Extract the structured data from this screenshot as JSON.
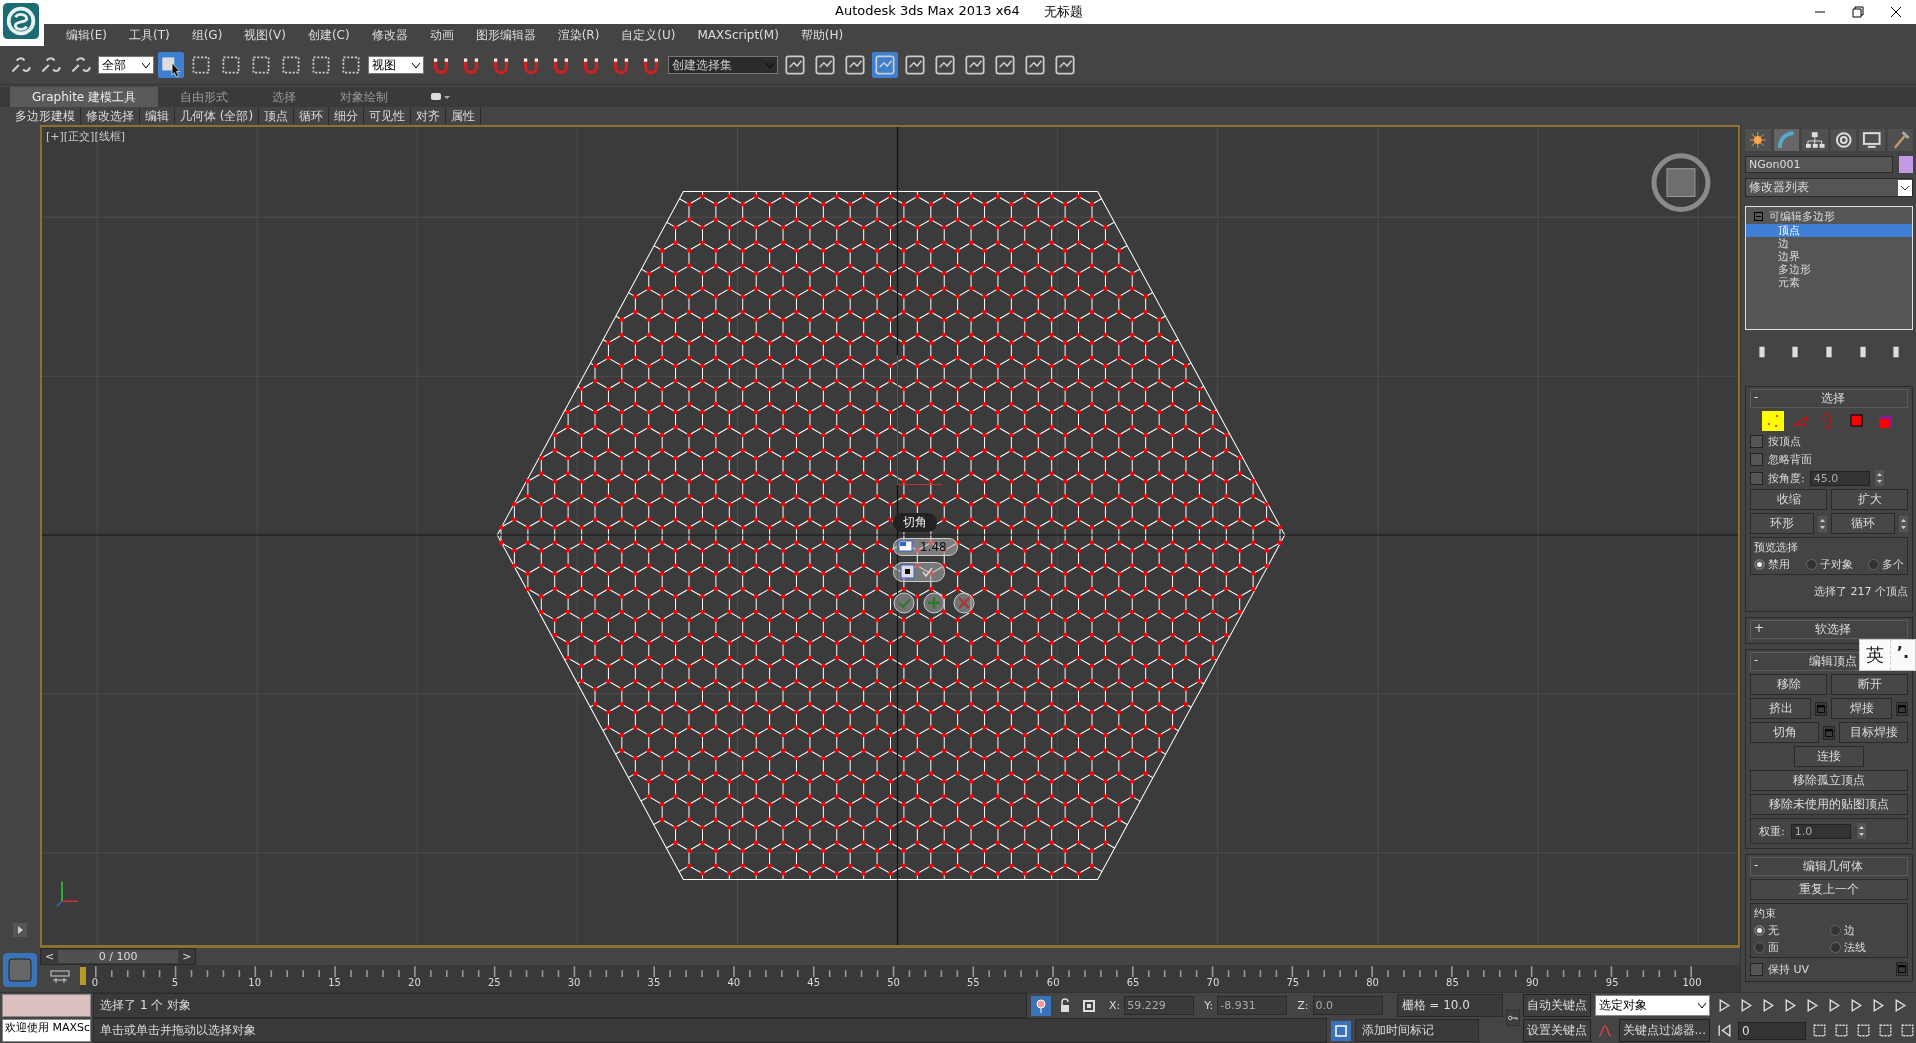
{
  "window": {
    "title": "Autodesk 3ds Max  2013 x64",
    "document": "无标题"
  },
  "menu": [
    "编辑(E)",
    "工具(T)",
    "组(G)",
    "视图(V)",
    "创建(C)",
    "修改器",
    "动画",
    "图形编辑器",
    "渲染(R)",
    "自定义(U)",
    "MAXScript(M)",
    "帮助(H)"
  ],
  "toolbar": {
    "selection_filter": "全部",
    "coordinate_system": "视图",
    "named_selection": "创建选择集"
  },
  "ribbon": {
    "tabs": [
      {
        "label": "Graphite 建模工具",
        "selected": true
      },
      {
        "label": "自由形式",
        "selected": false
      },
      {
        "label": "选择",
        "selected": false
      },
      {
        "label": "对象绘制",
        "selected": false
      }
    ],
    "panels": [
      "多边形建模",
      "修改选择",
      "编辑",
      "几何体 (全部)",
      "顶点",
      "循环",
      "细分",
      "可见性",
      "对齐",
      "属性"
    ]
  },
  "viewport": {
    "label": "[+][正交][线框]",
    "caddy": {
      "title": "切角",
      "value": "1.48"
    }
  },
  "command_panel": {
    "object": {
      "name": "NGon001",
      "color": "#c39ae6"
    },
    "modifier_list": "修改器列表",
    "stack": {
      "label": "可编辑多边形",
      "children": [
        {
          "label": "顶点",
          "selected": true
        },
        {
          "label": "边",
          "selected": false
        },
        {
          "label": "边界",
          "selected": false
        },
        {
          "label": "多边形",
          "selected": false
        },
        {
          "label": "元素",
          "selected": false
        }
      ]
    },
    "selection": {
      "toggle": "-",
      "title": "选择",
      "levels": [
        {
          "kind": "vertex",
          "selected": true
        },
        {
          "kind": "edge",
          "selected": false
        },
        {
          "kind": "border",
          "selected": false
        },
        {
          "kind": "polygon",
          "selected": false
        },
        {
          "kind": "element",
          "selected": false
        }
      ],
      "by_vertex": {
        "label": "按顶点",
        "checked": false
      },
      "ignore_backfacing": {
        "label": "忽略背面",
        "checked": false
      },
      "by_angle": {
        "label": "按角度:",
        "checked": false,
        "value": "45.0"
      },
      "buttons": [
        "收缩",
        "扩大"
      ],
      "spin_buttons": [
        "环形",
        "循环"
      ],
      "preview": {
        "title": "预览选择",
        "options": [
          {
            "label": "禁用",
            "selected": true
          },
          {
            "label": "子对象",
            "selected": false
          },
          {
            "label": "多个",
            "selected": false
          }
        ]
      },
      "status": "选择了 217 个顶点"
    },
    "soft_selection": {
      "toggle": "+",
      "title": "软选择"
    },
    "edit_vertices": {
      "toggle": "-",
      "title": "编辑顶点",
      "rows": [
        [
          {
            "label": "移除",
            "settings": false
          },
          {
            "label": "断开",
            "settings": false
          }
        ],
        [
          {
            "label": "挤出",
            "settings": true
          },
          {
            "label": "焊接",
            "settings": true
          }
        ],
        [
          {
            "label": "切角",
            "settings": true
          },
          {
            "label": "目标焊接",
            "settings": false
          }
        ],
        [
          {
            "label": "连接",
            "settings": false
          }
        ],
        [
          {
            "label": "移除孤立顶点",
            "settings": false
          }
        ],
        [
          {
            "label": "移除未使用的贴图顶点",
            "settings": false
          }
        ]
      ],
      "weight": {
        "label": "权重:",
        "value": "1.0"
      }
    },
    "edit_geometry": {
      "toggle": "-",
      "title": "编辑几何体",
      "repeat": "重复上一个",
      "constraints": {
        "title": "约束",
        "options": [
          {
            "label": "无",
            "selected": true
          },
          {
            "label": "边",
            "selected": false
          },
          {
            "label": "面",
            "selected": false
          },
          {
            "label": "法线",
            "selected": false
          }
        ]
      },
      "preserve_uv": {
        "label": "保持 UV",
        "checked": false
      }
    }
  },
  "ime": {
    "mode": "英",
    "punctuation": "’."
  },
  "timeline": {
    "prev": "<",
    "frame": "0 / 100",
    "next": ">",
    "ticks": [
      "0",
      "5",
      "10",
      "15",
      "20",
      "25",
      "30",
      "35",
      "40",
      "45",
      "50",
      "55",
      "60",
      "65",
      "70",
      "75",
      "80",
      "85",
      "90",
      "95",
      "100"
    ]
  },
  "status": {
    "listener": "欢迎使用 MAXSc",
    "selection": "选择了 1 个 对象",
    "prompt": "单击或单击并拖动以选择对象",
    "coords": [
      {
        "label": "X:",
        "value": "59.229"
      },
      {
        "label": "Y:",
        "value": "-8.931"
      },
      {
        "label": "Z:",
        "value": "0.0"
      }
    ],
    "grid": "栅格 = 10.0",
    "add_time_tag": "添加时间标记",
    "auto_key": "自动关键点",
    "key_mode": "选定对象",
    "set_key": "设置关键点",
    "key_filters": "关键点过滤器...",
    "current_frame": "0"
  }
}
